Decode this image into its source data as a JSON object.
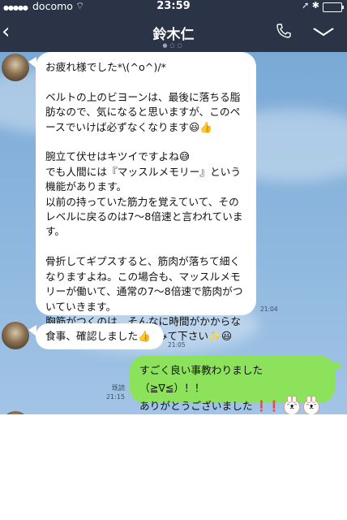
{
  "status": {
    "carrier": "docomo",
    "time": "23:59"
  },
  "header": {
    "title": "鈴木仁",
    "back_icon": "chevron-left-icon",
    "call_icon": "phone-icon",
    "menu_icon": "chevron-down-icon"
  },
  "messages": [
    {
      "side": "left",
      "text": "お疲れ様でした*\\(^o^)/*\n\nベルトの上のビヨーンは、最後に落ちる脂肪なので、気になると思いますが、このペースでいけば必ずなくなります😃👍\n\n腕立て伏せはキツイですよね😅\nでも人間には『マッスルメモリー』という機能があります。\n以前の持っていた筋力を覚えていて、そのレベルに戻るのは7〜8倍速と言われています。\n\n骨折してギプスすると、筋肉が落ちて細くなりますよね。この場合も、マッスルメモリーが働いて、通常の7〜8倍速で筋肉がついていきます。\n胸筋がつくのは、そんなに時間がかからないと思います。頑張ってみて下さい✨😃",
      "time": "21:04"
    },
    {
      "side": "left",
      "text": "食事、確認しました👍",
      "time": "21:05"
    },
    {
      "side": "right",
      "line1": "すごく良い事教わりました（≧∇≦）！！",
      "line2": "ありがとうございました",
      "read": "既読",
      "time": "21:15"
    }
  ],
  "colors": {
    "header": "#2a3446",
    "chat_bg": "#8fb8df",
    "my_bubble": "#8ce25a"
  }
}
